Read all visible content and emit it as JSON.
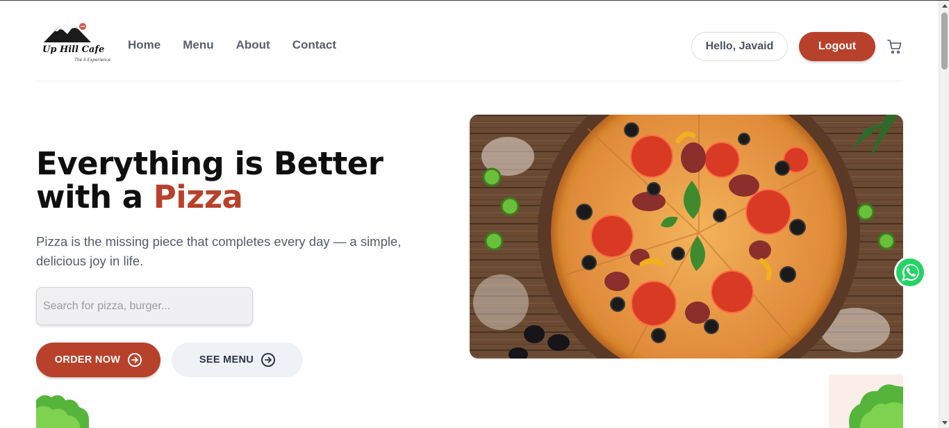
{
  "brand": {
    "name": "Up Hill Cafe",
    "tagline": "The S Experience"
  },
  "nav": {
    "items": [
      {
        "label": "Home"
      },
      {
        "label": "Menu"
      },
      {
        "label": "About"
      },
      {
        "label": "Contact"
      }
    ]
  },
  "account": {
    "greeting": "Hello, Javaid",
    "logout_label": "Logout",
    "cart_icon": "cart-icon"
  },
  "hero": {
    "title_line1": "Everything is Better",
    "title_line2_prefix": "with a ",
    "title_line2_accent": "Pizza",
    "description": "Pizza is the missing piece that completes every day — a simple, delicious joy in life.",
    "search_placeholder": "Search for pizza, burger...",
    "order_label": "ORDER NOW",
    "menu_label": "SEE MENU"
  },
  "colors": {
    "accent": "#b8412b",
    "nav_text": "#585f6b",
    "secondary_button_bg": "#eef1f6",
    "whatsapp": "#25d366"
  },
  "icons": [
    "cart-icon",
    "arrow-circle-right-icon",
    "whatsapp-icon"
  ]
}
